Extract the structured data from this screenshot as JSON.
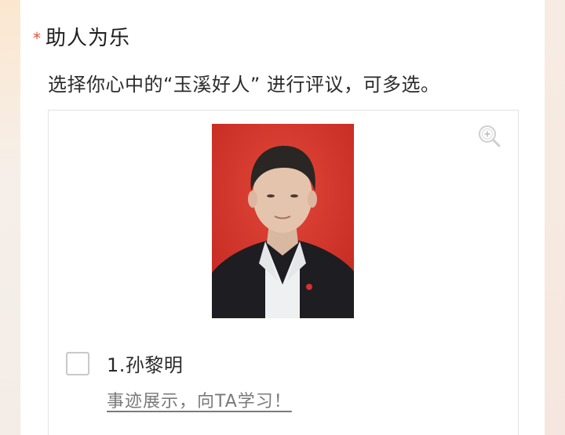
{
  "question": {
    "required_mark": "*",
    "title": "助人为乐",
    "description": "选择你心中的“玉溪好人” 进行评议，可多选。"
  },
  "option": {
    "label": "1.孙黎明",
    "link_text": "事迹展示，向TA学习！",
    "checked": false,
    "zoom_icon": "zoom-in-icon"
  },
  "colors": {
    "required": "#e4513f",
    "photo_background": "#d9372d"
  }
}
